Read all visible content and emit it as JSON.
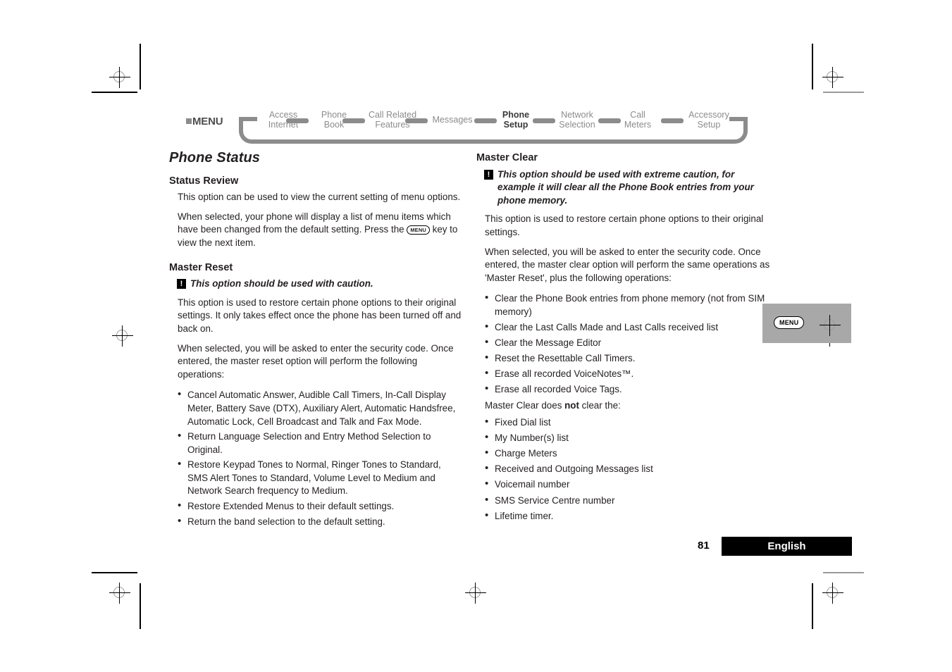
{
  "nav": {
    "menu_label": "MENU",
    "items": [
      {
        "line1": "Access",
        "line2": "Internet",
        "current": false
      },
      {
        "line1": "Phone",
        "line2": "Book",
        "current": false
      },
      {
        "line1": "Call Related",
        "line2": "Features",
        "current": false
      },
      {
        "line1": "Messages",
        "line2": "",
        "current": false
      },
      {
        "line1": "Phone",
        "line2": "Setup",
        "current": true
      },
      {
        "line1": "Network",
        "line2": "Selection",
        "current": false
      },
      {
        "line1": "Call",
        "line2": "Meters",
        "current": false
      },
      {
        "line1": "Accessory",
        "line2": "Setup",
        "current": false
      }
    ]
  },
  "left": {
    "section_title": "Phone Status",
    "status_review": {
      "heading": "Status Review",
      "p1": "This option can be used to view the current setting of menu options.",
      "p2_a": "When selected, your phone will display a list of menu items which have been changed from the default setting. Press the",
      "menu_key": "MENU",
      "p2_b": "key to view the next item."
    },
    "master_reset": {
      "heading": "Master Reset",
      "caution_icon": "!",
      "caution": "This option should be used with caution.",
      "p1": "This option is used to restore certain phone options to their original settings. It only takes effect once the phone has been turned off and back on.",
      "p2": "When selected, you will be asked to enter the security code. Once entered, the master reset option will perform the following operations:",
      "bullets": [
        "Cancel Automatic Answer, Audible Call Timers, In-Call Display Meter, Battery Save (DTX), Auxiliary Alert, Automatic Handsfree, Automatic Lock, Cell Broadcast and Talk and Fax Mode.",
        "Return Language Selection and Entry Method Selection to Original.",
        "Restore Keypad Tones to Normal, Ringer Tones to Standard, SMS Alert Tones to Standard, Volume Level to Medium and Network Search frequency to Medium.",
        "Restore Extended Menus to their default settings.",
        "Return the band selection to the default setting."
      ]
    }
  },
  "right": {
    "master_clear": {
      "heading": "Master Clear",
      "caution_icon": "!",
      "caution": "This option should be used with extreme caution, for example it will clear all the Phone Book entries from your phone memory.",
      "p1": "This option is used to restore certain phone options to their original settings.",
      "p2": "When selected, you will be asked to enter the security code. Once entered, the master clear option will perform the same operations as 'Master Reset', plus the following operations:",
      "bullets": [
        "Clear the Phone Book entries from phone memory (not from SIM memory)",
        "Clear the Last Calls Made and Last Calls received list",
        "Clear the Message Editor",
        "Reset the Resettable Call Timers.",
        "Erase all recorded VoiceNotes™.",
        "Erase all recorded Voice Tags."
      ],
      "not_clear_a": "Master Clear does ",
      "not_clear_bold": "not",
      "not_clear_b": " clear the:",
      "not_bullets": [
        "Fixed Dial list",
        "My Number(s) list",
        "Charge Meters",
        "Received and Outgoing Messages list",
        "Voicemail number",
        "SMS Service Centre number",
        "Lifetime timer."
      ]
    }
  },
  "thumb_tab": {
    "menu_key": "MENU"
  },
  "footer": {
    "page_number": "81",
    "language": "English"
  },
  "colors": {
    "nav_gray": "#8c8c8c",
    "nav_current": "#3a3a3a",
    "tab_gray": "#a8a8a8",
    "footer_bar": "#000000",
    "text": "#231f20"
  }
}
